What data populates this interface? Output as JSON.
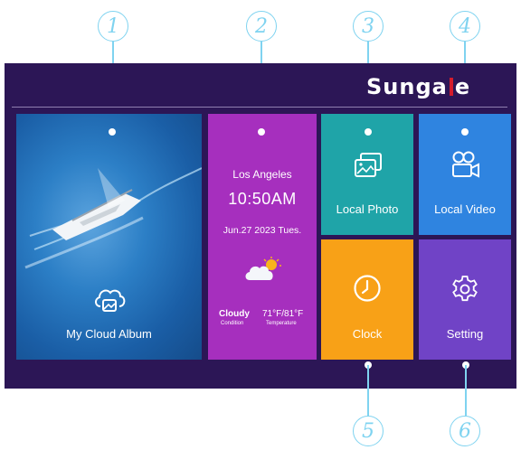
{
  "callouts": [
    "1",
    "2",
    "3",
    "4",
    "5",
    "6"
  ],
  "brand": {
    "name_part1": "Sunga",
    "name_part2": "e"
  },
  "tiles": {
    "cloud_album": {
      "label": "My Cloud Album",
      "icon": "cloud-photo-icon"
    },
    "weather": {
      "city": "Los Angeles",
      "time": "10:50AM",
      "date": "Jun.27 2023 Tues.",
      "condition_value": "Cloudy",
      "condition_label": "Condition",
      "temperature_value": "71°F/81°F",
      "temperature_label": "Temperature",
      "icon": "partly-cloudy-icon"
    },
    "local_photo": {
      "label": "Local Photo",
      "icon": "photos-icon"
    },
    "local_video": {
      "label": "Local Video",
      "icon": "video-camera-icon"
    },
    "clock": {
      "label": "Clock",
      "icon": "clock-icon"
    },
    "setting": {
      "label": "Setting",
      "icon": "gear-icon"
    }
  },
  "colors": {
    "background": "#2c1656",
    "weather": "#a62fbe",
    "local_photo": "#1fa4a8",
    "local_video": "#2f84e0",
    "clock": "#f8a117",
    "setting": "#7043c6",
    "callout": "#7fd3f0"
  }
}
